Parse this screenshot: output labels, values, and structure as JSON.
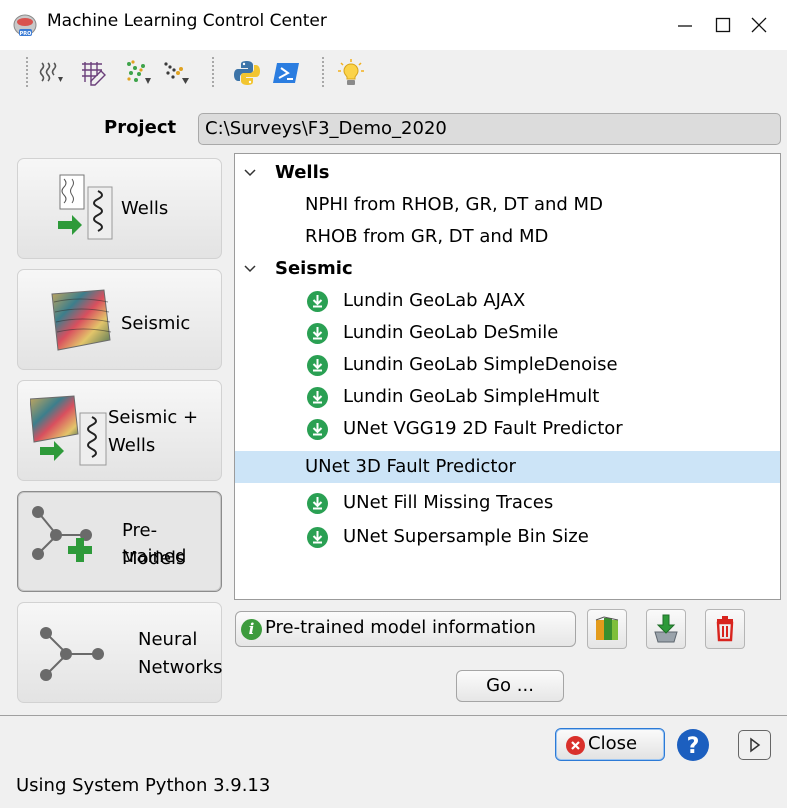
{
  "window": {
    "title": "Machine Learning Control Center",
    "app_icon": "od-pro-app-icon",
    "controls": [
      "minimize-icon",
      "maximize-icon",
      "close-icon"
    ]
  },
  "toolbar": {
    "buttons": [
      "wells-import-icon",
      "grid-draw-icon",
      "scatter-import-icon",
      "pointset-import-icon",
      "python-icon",
      "powershell-icon",
      "lightbulb-icon"
    ]
  },
  "project": {
    "label": "Project",
    "value": "C:\\Surveys\\F3_Demo_2020"
  },
  "categories": [
    {
      "label": "Wells",
      "icon": "wells-icon",
      "selected": false
    },
    {
      "label": "Seismic",
      "icon": "seismic-icon",
      "selected": false
    },
    {
      "label_line1": "Seismic +",
      "label_line2": "Wells",
      "icon": "seismic-wells-icon",
      "selected": false
    },
    {
      "label_line1": "Pre-trained",
      "label_line2": "Models",
      "icon": "pretrained-models-icon",
      "selected": true
    },
    {
      "label_line1": "Neural",
      "label_line2": "Networks",
      "icon": "neural-network-icon",
      "selected": false
    }
  ],
  "tree": {
    "groups": [
      {
        "label": "Wells",
        "items": [
          {
            "label": "NPHI from RHOB, GR, DT and MD",
            "download": false
          },
          {
            "label": "RHOB from GR, DT and MD",
            "download": false
          }
        ]
      },
      {
        "label": "Seismic",
        "items": [
          {
            "label": "Lundin GeoLab AJAX",
            "download": true
          },
          {
            "label": "Lundin GeoLab DeSmile",
            "download": true
          },
          {
            "label": "Lundin GeoLab SimpleDenoise",
            "download": true
          },
          {
            "label": "Lundin GeoLab SimpleHmult",
            "download": true
          },
          {
            "label": "UNet VGG19 2D Fault Predictor",
            "download": true
          },
          {
            "label": "UNet 3D Fault Predictor",
            "download": false,
            "selected": true
          },
          {
            "label": "UNet Fill Missing Traces",
            "download": true
          },
          {
            "label": "UNet Supersample Bin Size",
            "download": true
          }
        ]
      }
    ]
  },
  "actions": {
    "info_label": "Pre-trained model information",
    "go_label": "Go ...",
    "close_label": "Close",
    "help_symbol": "?"
  },
  "status": {
    "text": "Using System Python 3.9.13"
  },
  "colors": {
    "selection": "#cce4f7",
    "download_green": "#2aa053",
    "close_red": "#d9302b",
    "help_blue": "#1c5fbf",
    "delete_red": "#d8241e"
  }
}
